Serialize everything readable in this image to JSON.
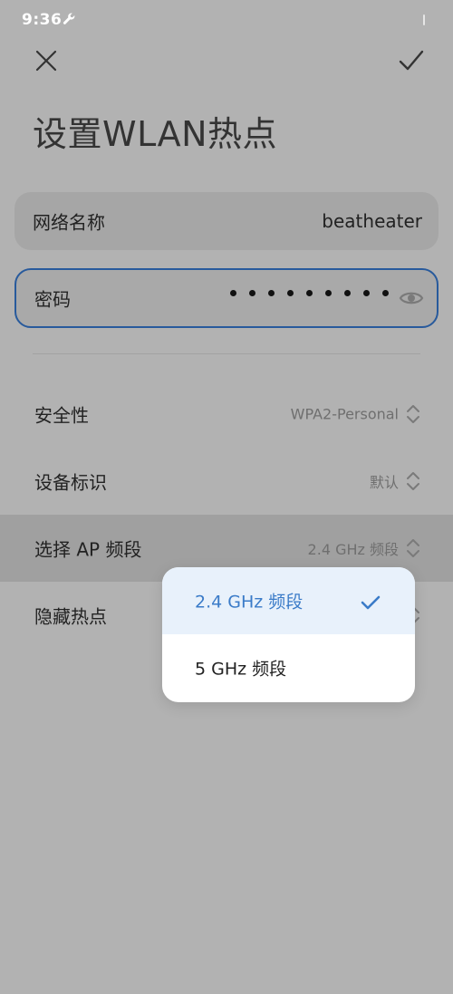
{
  "status_bar": {
    "time": "9:36",
    "icons": [
      "wrench-icon"
    ]
  },
  "toolbar": {
    "close_icon": "close-icon",
    "confirm_icon": "check-icon"
  },
  "page": {
    "title": "设置WLAN热点"
  },
  "form": {
    "network_name_label": "网络名称",
    "network_name_value": "beatheater",
    "password_label": "密码",
    "password_mask": "•••••••••",
    "password_dot_count": 9,
    "show_password_icon": "eye-icon"
  },
  "settings": [
    {
      "label": "安全性",
      "value": "WPA2-Personal"
    },
    {
      "label": "设备标识",
      "value": "默认"
    },
    {
      "label": "选择 AP 频段",
      "value": "2.4 GHz 频段"
    },
    {
      "label": "隐藏热点",
      "value": ""
    }
  ],
  "dropdown": {
    "options": [
      "2.4 GHz 频段",
      "5 GHz 频段"
    ],
    "selected_index": 0
  },
  "colors": {
    "accent": "#3a7bc8",
    "focus_border": "#285a9c",
    "scrim": "#b2b2b2",
    "menu_bg": "#ffffff",
    "selected_bg": "#e8f1fb"
  }
}
